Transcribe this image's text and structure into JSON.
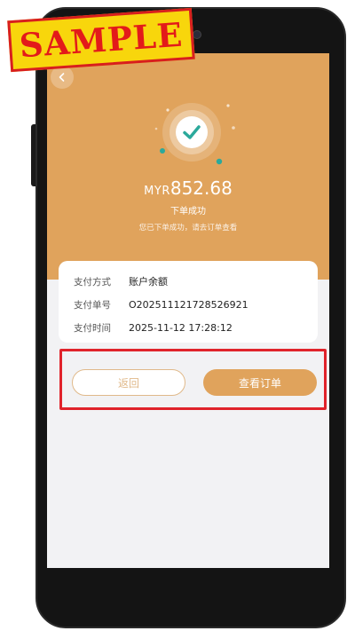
{
  "payment_success": {
    "currency": "MYR",
    "amount": "852.68",
    "title": "下单成功",
    "subtitle": "您已下单成功，请去订单查看"
  },
  "details": [
    {
      "label": "支付方式",
      "value": "账户余额"
    },
    {
      "label": "支付单号",
      "value": "O2025111217285269​21"
    },
    {
      "label": "支付时间",
      "value": "2025-11-12 17:28:12"
    }
  ],
  "actions": {
    "back_label": "返回",
    "view_order_label": "查看订单"
  },
  "watermark": {
    "text": "SAMPLE"
  },
  "colors": {
    "accent": "#e0a35c",
    "check": "#2ba99b",
    "highlight": "#e0232b",
    "stamp_bg": "#f8d60c",
    "stamp_text": "#e31a1a"
  },
  "icons": [
    "back-arrow-icon",
    "success-check-icon"
  ]
}
